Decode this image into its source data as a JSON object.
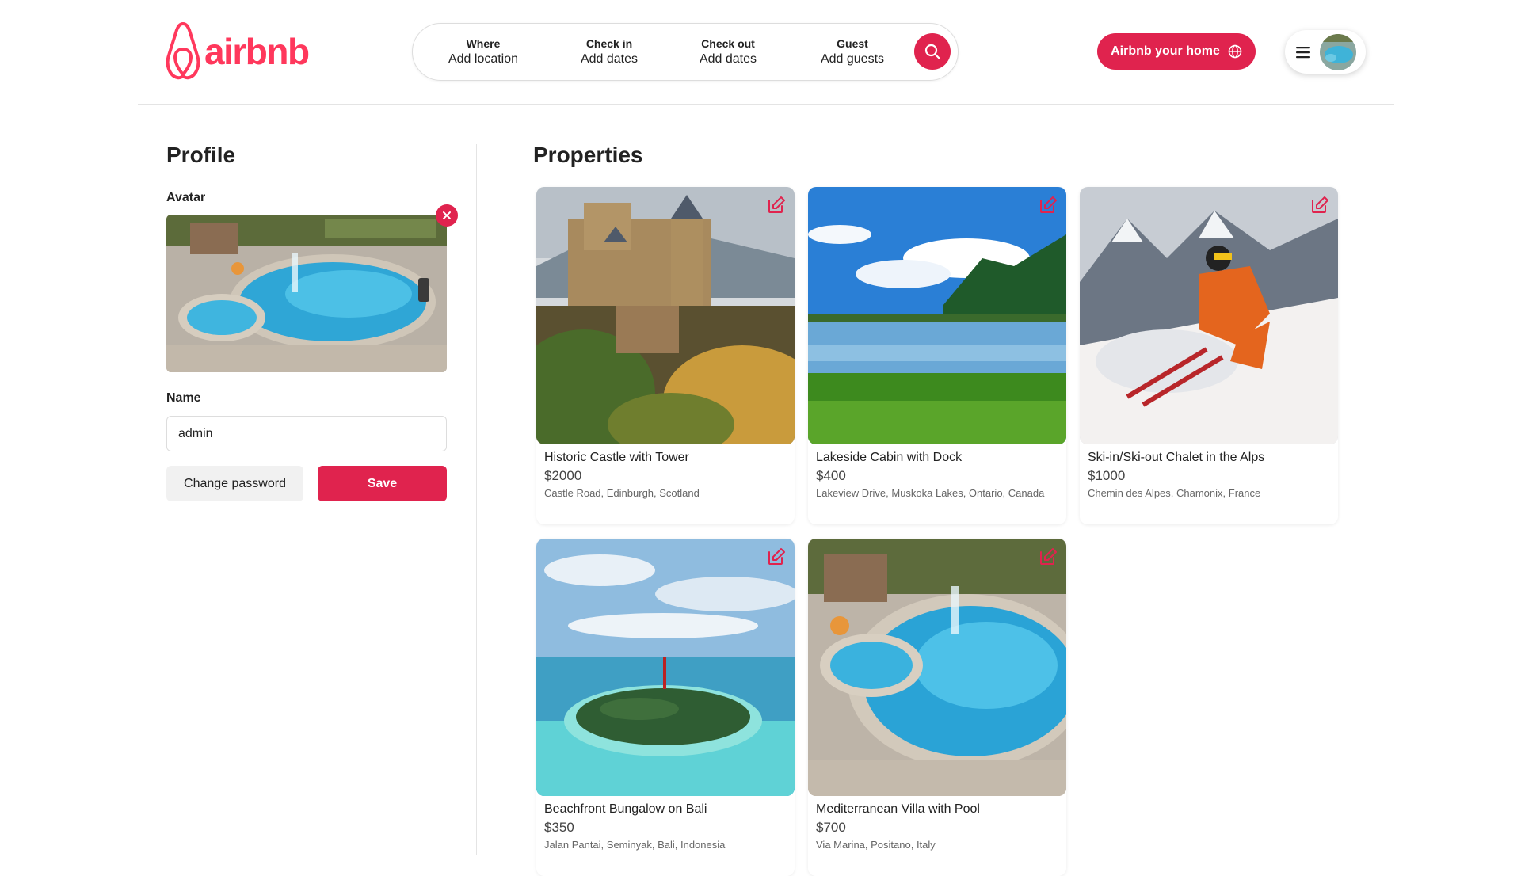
{
  "header": {
    "logo_text": "airbnb",
    "search": {
      "where_label": "Where",
      "where_value": "Add location",
      "checkin_label": "Check in",
      "checkin_value": "Add dates",
      "checkout_label": "Check out",
      "checkout_value": "Add dates",
      "guest_label": "Guest",
      "guest_value": "Add guests"
    },
    "host_button": "Airbnb your home"
  },
  "profile": {
    "title": "Profile",
    "avatar_label": "Avatar",
    "name_label": "Name",
    "name_value": "admin",
    "change_password": "Change password",
    "save": "Save"
  },
  "properties": {
    "title": "Properties",
    "items": [
      {
        "title": "Historic Castle with Tower",
        "price": "$2000",
        "address": "Castle Road, Edinburgh, Scotland"
      },
      {
        "title": "Lakeside Cabin with Dock",
        "price": "$400",
        "address": "Lakeview Drive, Muskoka Lakes, Ontario, Canada"
      },
      {
        "title": "Ski-in/Ski-out Chalet in the Alps",
        "price": "$1000",
        "address": "Chemin des Alpes, Chamonix, France"
      },
      {
        "title": "Beachfront Bungalow on Bali",
        "price": "$350",
        "address": "Jalan Pantai, Seminyak, Bali, Indonesia"
      },
      {
        "title": "Mediterranean Villa with Pool",
        "price": "$700",
        "address": "Via Marina, Positano, Italy"
      }
    ]
  },
  "colors": {
    "brand": "#FF385C",
    "accent": "#E0234E"
  },
  "icons": [
    "airbnb-logo-icon",
    "search-icon",
    "globe-icon",
    "menu-icon",
    "close-icon",
    "edit-icon"
  ]
}
